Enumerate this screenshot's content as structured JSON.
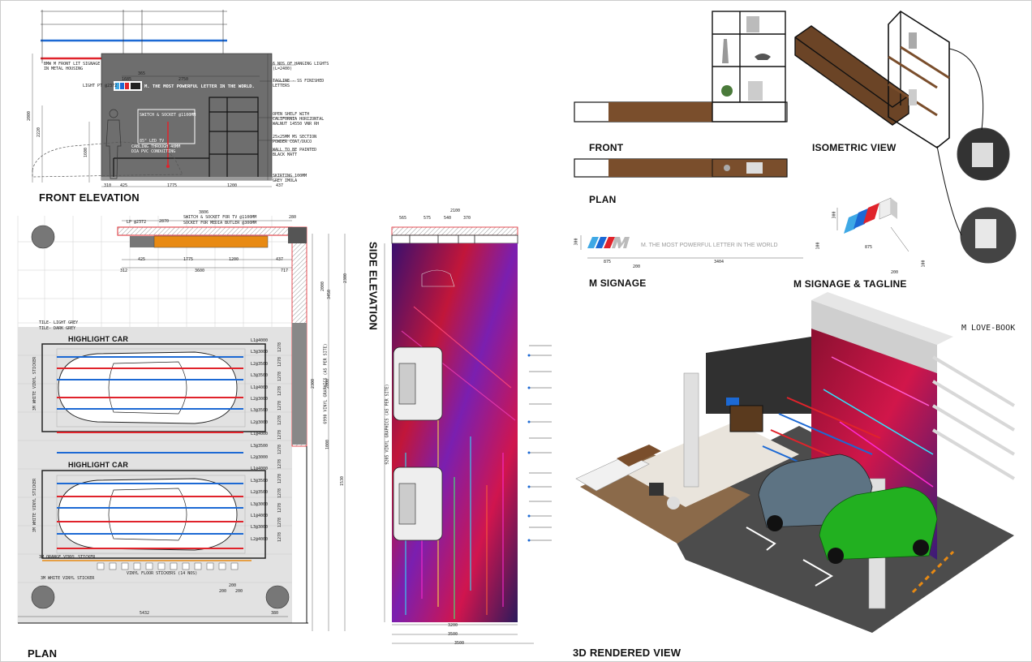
{
  "titles": {
    "front_elevation": "FRONT ELEVATION",
    "plan": "PLAN",
    "side_elevation": "SIDE ELEVATION",
    "front": "FRONT",
    "isometric_view": "ISOMETRIC VIEW",
    "shelf_plan": "PLAN",
    "m_signage": "M SIGNAGE",
    "m_signage_tagline": "M SIGNAGE & TAGLINE",
    "rendered_view": "3D RENDERED VIEW",
    "m_love_book": "M LOVE-BOOK"
  },
  "front_elevation_notes": {
    "bmw_signage": "BMW M FRONT LIT SIGNAGE\nIN METAL HOUSING",
    "light_pt": "LIGHT PT @2372",
    "tagline_text": "M. THE MOST POWERFUL LETTER IN THE WORLD.",
    "hanging_lights": "6 NOS OF HANGING LIGHTS\n(L=2400)",
    "tagline_note": "TAGLINE - SS FINISHED\nLETTERS",
    "open_shelf": "OPEN SHELF WITH\nCALIFORNIA HORIZONTAL\nWALNUT 14550 VNR RH",
    "ms_section": "25x25MM MS SECTION\nPOWDER COAT/DUCO",
    "wall_paint": "WALL TO BE PAINTED\nBLACK MATT",
    "skirting": "SKIRTING 100MM\nGREY IMOLA",
    "switch_socket": "SWITCH & SOCKET @1100MM",
    "led_tv": "85\" LED TV",
    "cabling": "CABLING THROUGH 40MM\nDIA PVC CONDUITING",
    "dims_top": [
      "365",
      "1685",
      "2750"
    ],
    "dims_bottom": [
      "310",
      "425",
      "1775",
      "1200",
      "437"
    ],
    "dims_left": [
      "2000",
      "2220",
      "1600"
    ]
  },
  "plan_notes": {
    "lp": "LP @2372",
    "switch_tv": "SWITCH & SOCKET FOR TV @1100MM",
    "socket_media": "SOCKET FOR MEDIA BUTLER @300MM",
    "dims_top": [
      "3806",
      "2870",
      "280"
    ],
    "dims_shelf": [
      "425",
      "1775",
      "1200",
      "437"
    ],
    "dims_below": [
      "312",
      "3600",
      "717"
    ],
    "tile_light": "TILE- LIGHT GREY",
    "tile_dark": "TILE- DARK GREY",
    "highlight_car_1": "HIGHLIGHT CAR",
    "highlight_car_2": "HIGHLIGHT CAR",
    "white_sticker_v1": "3M WHITE VINYL STICKER",
    "white_sticker_v2": "3M WHITE VINYL STICKER",
    "orange_sticker": "3M ORANGE VINYL STICKER",
    "white_sticker_h": "3M WHITE VINYL STICKER",
    "floor_stickers": "VINYL FLOOR STICKERS (14 NOS)",
    "dims_sticker": [
      "200",
      "200",
      "200"
    ],
    "dim_bottom": "5432",
    "dim_corner": "380",
    "light_labels": [
      "L1@4000",
      "L3@3000",
      "L2@3500",
      "L3@3500",
      "L1@4000",
      "L2@3000",
      "L3@3500",
      "L2@3000",
      "L1@4000",
      "L3@3500",
      "L2@3000",
      "L1@4000",
      "L3@3500",
      "L2@3500",
      "L3@3000",
      "L1@4000",
      "L3@3000",
      "L2@4000"
    ],
    "dims_right": [
      "2000",
      "3450",
      "2300",
      "2300",
      "1000",
      "2000",
      "1530"
    ],
    "vinyl_note": "6990 VINYL GRAPHICS (AS PER SITE)",
    "ms_dims": [
      "1278",
      "1278",
      "1278",
      "1278",
      "1278",
      "1278",
      "1278",
      "1278",
      "1278",
      "1278",
      "1278",
      "1278",
      "1278",
      "1278"
    ]
  },
  "side_elevation_notes": {
    "dims_top": [
      "2100",
      "565",
      "575",
      "540",
      "370"
    ],
    "vinyl_note": "9205 VINYL GRAPHICS (AS PER SITE)",
    "dims_bottom": [
      "3200",
      "3500",
      "3500"
    ]
  },
  "shelf_dims": {
    "signage_h": "300",
    "signage_w": "875",
    "gap": "200",
    "tagline_w": "3404",
    "tagline_h": "100",
    "tagline_text": "M. THE MOST POWERFUL LETTER IN THE WORLD",
    "iso_h": "300",
    "iso_w": "875",
    "iso_d": "200",
    "iso_t": "100"
  },
  "colors": {
    "walnut": "#7a4e2c",
    "wall_grey": "#6e6e6e",
    "bmw_blue": "#1c69d4",
    "bmw_red": "#e0232b",
    "m_blue_light": "#3ea8e5",
    "orange": "#e88a13",
    "floor_light": "#e2e2e2"
  },
  "icons": [
    "bmw-m-logo-icon",
    "person-silhouette-icon",
    "car-top-view-icon",
    "car-front-view-icon",
    "column-icon"
  ]
}
